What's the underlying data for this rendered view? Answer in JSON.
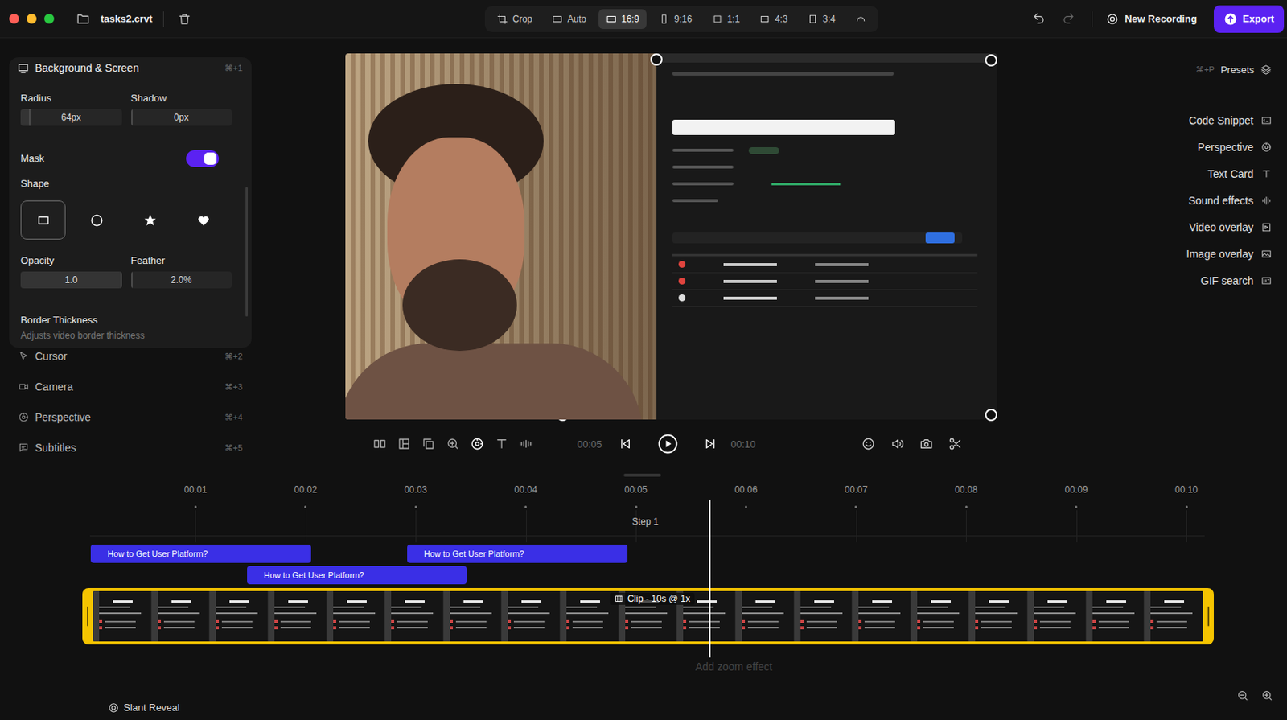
{
  "window": {
    "title": "tasks2.crvt"
  },
  "toolbar": {
    "crop": "Crop",
    "ratios": [
      {
        "label": "Auto",
        "selected": false
      },
      {
        "label": "16:9",
        "selected": true
      },
      {
        "label": "9:16",
        "selected": false
      },
      {
        "label": "1:1",
        "selected": false
      },
      {
        "label": "4:3",
        "selected": false
      },
      {
        "label": "3:4",
        "selected": false
      }
    ]
  },
  "actions": {
    "new_recording": "New Recording",
    "export": "Export"
  },
  "left_panel": {
    "section": {
      "title": "Background & Screen",
      "shortcut": "⌘+1",
      "expanded": true,
      "fields_top": [
        {
          "label": "Radius",
          "value": "64px",
          "level": 0.1
        },
        {
          "label": "Shadow",
          "value": "0px",
          "level": 0
        }
      ],
      "mask": {
        "label": "Mask",
        "on": true
      },
      "shape": {
        "label": "Shape",
        "options": [
          {
            "kind": "rectangle",
            "selected": true
          },
          {
            "kind": "circle",
            "selected": false
          },
          {
            "kind": "star",
            "selected": false
          },
          {
            "kind": "heart",
            "selected": false
          }
        ]
      },
      "fields_bottom": [
        {
          "label": "Opacity",
          "value": "1.0",
          "level": 1
        },
        {
          "label": "Feather",
          "value": "2.0%",
          "level": 0.02
        }
      ],
      "border": {
        "label": "Border Thickness",
        "description": "Adjusts video border thickness"
      }
    },
    "items": [
      {
        "label": "Cursor",
        "shortcut": "⌘+2"
      },
      {
        "label": "Camera",
        "shortcut": "⌘+3"
      },
      {
        "label": "Perspective",
        "shortcut": "⌘+4"
      },
      {
        "label": "Subtitles",
        "shortcut": "⌘+5"
      }
    ]
  },
  "right_panel": {
    "presets": {
      "shortcut": "⌘+P",
      "label": "Presets"
    },
    "items": [
      "Code Snippet",
      "Perspective",
      "Text Card",
      "Sound effects",
      "Video overlay",
      "Image overlay",
      "GIF search"
    ]
  },
  "player": {
    "current_time": "00:05",
    "total_time": "00:10"
  },
  "timeline": {
    "ticks": [
      "00:01",
      "00:02",
      "00:03",
      "00:04",
      "00:05",
      "00:06",
      "00:07",
      "00:08",
      "00:09",
      "00:10"
    ],
    "marker": "Step 1",
    "subtitles": [
      {
        "text": "How to Get User Platform?"
      },
      {
        "text": "How to Get User Platform?"
      },
      {
        "text": "How to Get User Platform?"
      }
    ],
    "clip": {
      "label": "Clip - 10s @ 1x",
      "selected": true
    },
    "playhead": {
      "level": 0.567
    },
    "zoom_hint": "Add zoom effect",
    "transition": "Slant Reveal"
  }
}
